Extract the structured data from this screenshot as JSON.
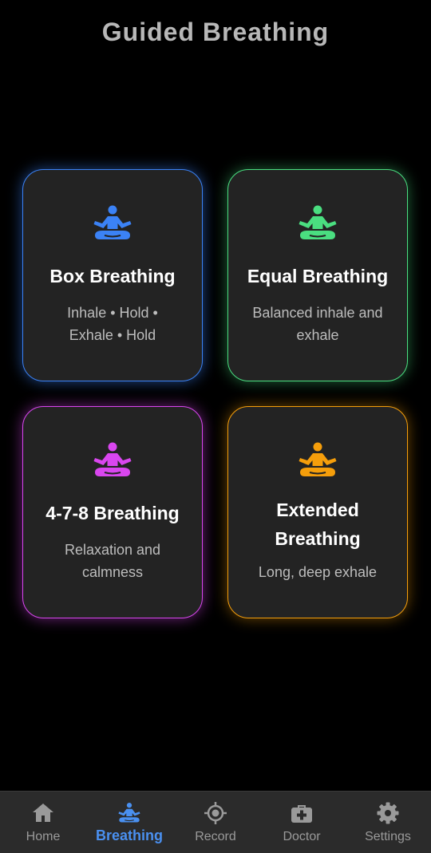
{
  "header": {
    "title": "Guided Breathing"
  },
  "cards": [
    {
      "title": "Box Breathing",
      "desc_line1": "Inhale • Hold •",
      "desc_line2": "Exhale • Hold",
      "icon": "meditation-icon",
      "color": "#3b82f6"
    },
    {
      "title": "Equal Breathing",
      "desc_line1": "Balanced inhale and",
      "desc_line2": "exhale",
      "icon": "meditation-icon",
      "color": "#4ade80"
    },
    {
      "title": "4-7-8 Breathing",
      "desc_line1": "Relaxation and",
      "desc_line2": "calmness",
      "icon": "meditation-icon",
      "color": "#d946ef"
    },
    {
      "title_line1": "Extended",
      "title_line2": "Breathing",
      "desc_line1": "Long, deep exhale",
      "icon": "meditation-icon",
      "color": "#f59e0b"
    }
  ],
  "nav": {
    "items": [
      {
        "label": "Home",
        "icon": "home-icon"
      },
      {
        "label": "Breathing",
        "icon": "meditation-icon",
        "active": true
      },
      {
        "label": "Record",
        "icon": "target-icon"
      },
      {
        "label": "Doctor",
        "icon": "medical-kit-icon"
      },
      {
        "label": "Settings",
        "icon": "gear-icon"
      }
    ],
    "active_color": "#4a90f0",
    "inactive_color": "#9a9a9a"
  }
}
